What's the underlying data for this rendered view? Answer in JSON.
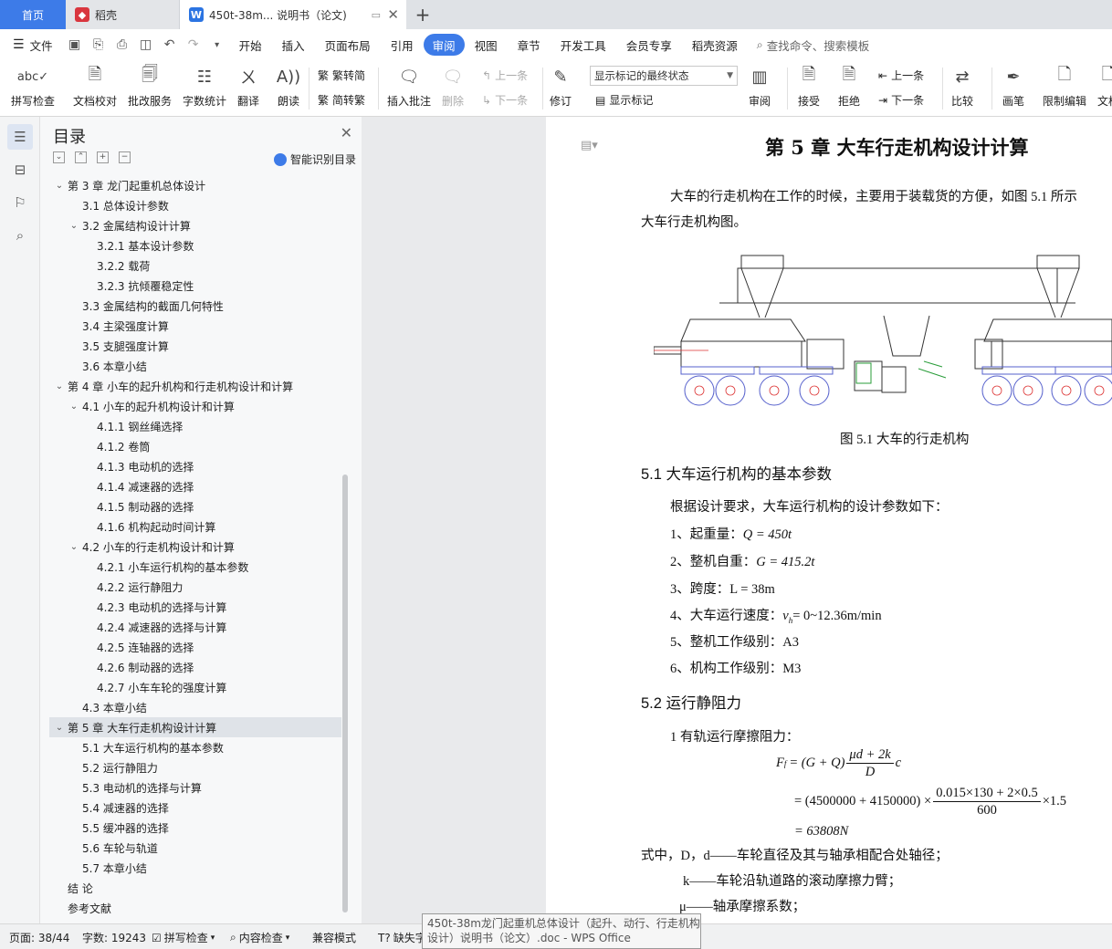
{
  "tabs": {
    "home": "首页",
    "daoke": "稻壳",
    "doc": "450t-38m... 说明书（论文)",
    "add": "+"
  },
  "menu": {
    "file": "文件",
    "items": [
      "开始",
      "插入",
      "页面布局",
      "引用",
      "审阅",
      "视图",
      "章节",
      "开发工具",
      "会员专享",
      "稻壳资源"
    ],
    "active": "审阅",
    "search": "查找命令、搜索模板"
  },
  "ribbon": {
    "spell": "拼写检查",
    "proof": "文档校对",
    "annotate": "批改服务",
    "wordcount": "字数统计",
    "translate": "翻译",
    "read": "朗读",
    "trad": "繁转简",
    "simp": "简转繁",
    "insert_comment": "插入批注",
    "delete": "删除",
    "prev": "上一条",
    "next": "下一条",
    "revise": "修订",
    "status_select": "显示标记的最终状态",
    "show_marks": "显示标记",
    "review": "审阅",
    "accept": "接受",
    "reject": "拒绝",
    "prev2": "上一条",
    "next2": "下一条",
    "compare": "比较",
    "pen": "画笔",
    "restrict": "限制编辑",
    "doc_more": "文档"
  },
  "toc": {
    "title": "目录",
    "smart": "智能识别目录",
    "items": [
      {
        "label": "第 3 章  龙门起重机总体设计",
        "level": 1
      },
      {
        "label": "3.1 总体设计参数",
        "level": 2
      },
      {
        "label": "3.2 金属结构设计计算",
        "level": 2
      },
      {
        "label": "3.2.1 基本设计参数",
        "level": 3
      },
      {
        "label": "3.2.2 载荷",
        "level": 3
      },
      {
        "label": "3.2.3 抗倾覆稳定性",
        "level": 3
      },
      {
        "label": "3.3 金属结构的截面几何特性",
        "level": 2
      },
      {
        "label": "3.4 主梁强度计算",
        "level": 2
      },
      {
        "label": "3.5 支腿强度计算",
        "level": 2
      },
      {
        "label": "3.6 本章小结",
        "level": 2
      },
      {
        "label": "第 4 章  小车的起升机构和行走机构设计和计算",
        "level": 1
      },
      {
        "label": "4.1 小车的起升机构设计和计算",
        "level": 2
      },
      {
        "label": "4.1.1 钢丝绳选择",
        "level": 3
      },
      {
        "label": "4.1.2 卷筒",
        "level": 3
      },
      {
        "label": "4.1.3 电动机的选择",
        "level": 3
      },
      {
        "label": "4.1.4 减速器的选择",
        "level": 3
      },
      {
        "label": "4.1.5 制动器的选择",
        "level": 3
      },
      {
        "label": "4.1.6 机构起动时间计算",
        "level": 3
      },
      {
        "label": "4.2 小车的行走机构设计和计算",
        "level": 2
      },
      {
        "label": "4.2.1 小车运行机构的基本参数",
        "level": 3
      },
      {
        "label": "4.2.2 运行静阻力",
        "level": 3
      },
      {
        "label": "4.2.3 电动机的选择与计算",
        "level": 3
      },
      {
        "label": "4.2.4 减速器的选择与计算",
        "level": 3
      },
      {
        "label": "4.2.5 连轴器的选择",
        "level": 3
      },
      {
        "label": "4.2.6 制动器的选择",
        "level": 3
      },
      {
        "label": "4.2.7 小车车轮的强度计算",
        "level": 3
      },
      {
        "label": "4.3 本章小结",
        "level": 2
      },
      {
        "label": "第 5 章  大车行走机构设计计算",
        "level": 1
      },
      {
        "label": "5.1 大车运行机构的基本参数",
        "level": 2
      },
      {
        "label": "5.2 运行静阻力",
        "level": 2
      },
      {
        "label": "5.3 电动机的选择与计算",
        "level": 2
      },
      {
        "label": "5.4 减速器的选择",
        "level": 2
      },
      {
        "label": "5.5 缓冲器的选择",
        "level": 2
      },
      {
        "label": "5.6 车轮与轨道",
        "level": 2
      },
      {
        "label": "5.7 本章小结",
        "level": 2
      },
      {
        "label": "结  论",
        "level": 0
      },
      {
        "label": "参考文献",
        "level": 0
      }
    ]
  },
  "doc": {
    "chapter_title": "第 5 章  大车行走机构设计计算",
    "intro1": "大车的行走机构在工作的时候，主要用于装载货的方便，如图 5.1 所示",
    "intro2": "大车行走机构图。",
    "fig_caption": "图 5.1  大车的行走机构",
    "h51": "5.1 大车运行机构的基本参数",
    "p_req": "根据设计要求，大车运行机构的设计参数如下：",
    "param1": "1、起重量：",
    "param1v": "Q = 450t",
    "param2": "2、整机自重：",
    "param2v": "G = 415.2t",
    "param3": "3、跨度：L = 38m",
    "param4": "4、大车运行速度：",
    "param4v": "= 0~12.36m/min",
    "param5": "5、整机工作级别：A3",
    "param6": "6、机构工作级别：M3",
    "h52": "5.2 运行静阻力",
    "p_fric": "1 有轨运行摩擦阻力：",
    "f_lhs": "F",
    "f_eq1": "= (G + Q)",
    "f_num1": "μd + 2k",
    "f_den1": "D",
    "f_c": "c",
    "f_eq2": "= (4500000 + 4150000) ×",
    "f_num2": "0.015×130 + 2×0.5",
    "f_den2": "600",
    "f_mul": "×1.5",
    "f_eq3": "= 63808N",
    "where1": "式中，D，d——车轮直径及其与轴承相配合处轴径；",
    "where2": "k——车轮沿轨道路的滚动摩擦力臂；",
    "where3": "μ——轴承摩擦系数；"
  },
  "status": {
    "page": "页面: 38/44",
    "words": "字数: 19243",
    "spell": "拼写检查",
    "content": "内容检查",
    "compat": "兼容模式",
    "font": "缺失字体"
  },
  "tooltip": {
    "line1": "450t-38m龙门起重机总体设计（起升、动行、行走机构",
    "line2": "设计）说明书（论文）.doc - WPS Office"
  },
  "colors": {
    "accent": "#3d7be8",
    "daoke": "#d9363e"
  }
}
